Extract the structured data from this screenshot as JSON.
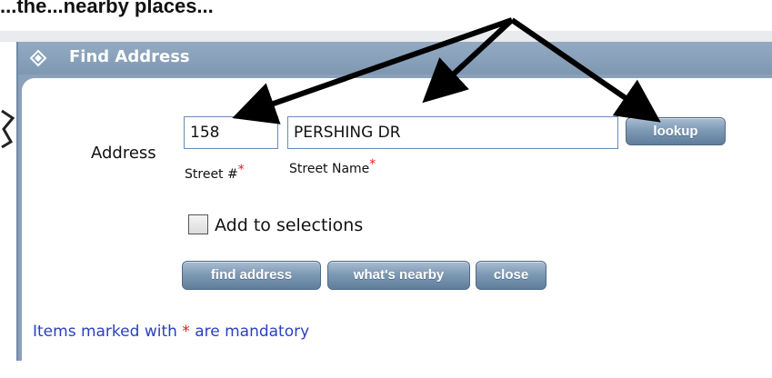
{
  "top_caption": "...the...nearby places...",
  "dialog": {
    "title": "Find Address",
    "address_label": "Address",
    "street_number": {
      "value": "158",
      "label": "Street #",
      "required_mark": "*"
    },
    "street_name": {
      "value": "PERSHING DR",
      "label": "Street Name",
      "required_mark": "*"
    },
    "lookup_label": "lookup",
    "add_to_selections": {
      "label": "Add to selections",
      "checked": false
    },
    "buttons": {
      "find_address": "find address",
      "whats_nearby": "what's nearby",
      "close": "close"
    },
    "mandatory_note": {
      "before": "Items marked with ",
      "star": "*",
      "after": " are mandatory"
    }
  },
  "colors": {
    "dialog_frame": "#8aa1b9",
    "button": "#7f9ab5",
    "required_star": "#e02020",
    "note_text": "#2a3fbf"
  }
}
